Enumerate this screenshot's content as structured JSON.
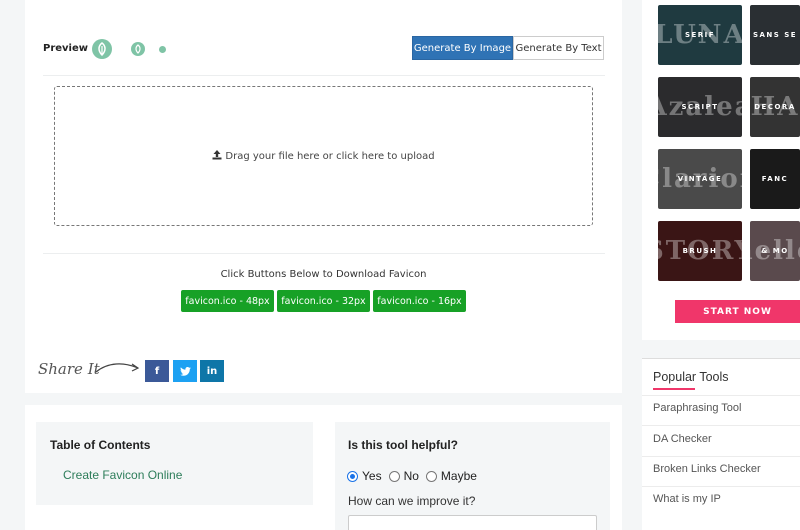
{
  "colors": {
    "primary_button": "#2f73b5",
    "download_button": "#17a126",
    "accent": "#f0366a",
    "link": "#2d7d5a"
  },
  "preview": {
    "label": "Preview",
    "icon": "leaf-favicon-icon"
  },
  "generate": {
    "by_image": "Generate By Image",
    "by_text": "Generate By Text"
  },
  "upload": {
    "text": "Drag your file here or click here to upload",
    "icon": "upload-icon"
  },
  "download": {
    "title": "Click Buttons Below to Download Favicon",
    "buttons": [
      "favicon.ico - 48px",
      "favicon.ico - 32px",
      "favicon.ico - 16px"
    ]
  },
  "share": {
    "label": "Share It",
    "facebook": "f",
    "twitter": "twitter-icon",
    "linkedin": "in"
  },
  "toc": {
    "title": "Table of Contents",
    "items": [
      "Create Favicon Online"
    ]
  },
  "feedback": {
    "question": "Is this tool helpful?",
    "options": [
      "Yes",
      "No",
      "Maybe"
    ],
    "selected": "Yes",
    "improve_label": "How can we improve it?"
  },
  "ad": {
    "tiles": [
      {
        "label": "SERIF",
        "big": "LUNA",
        "bg": "#1f3a40"
      },
      {
        "label": "SANS SE",
        "big": "",
        "bg": "#2a2f33"
      },
      {
        "label": "SCRIPT",
        "big": "Azalea",
        "bg": "#2b2b2d"
      },
      {
        "label": "DECORA",
        "big": "HA",
        "bg": "#333333"
      },
      {
        "label": "VINTAGE",
        "big": "Clarion",
        "bg": "#4a4a4a"
      },
      {
        "label": "FANC",
        "big": "",
        "bg": "#1a1a1a"
      },
      {
        "label": "BRUSH",
        "big": "STORY",
        "bg": "#3a1515"
      },
      {
        "label": "& MO",
        "big": "hello",
        "bg": "#5a4a4d"
      }
    ],
    "cta": "START NOW"
  },
  "popular": {
    "title": "Popular Tools",
    "items": [
      "Paraphrasing Tool",
      "DA Checker",
      "Broken Links Checker",
      "What is my IP"
    ]
  }
}
